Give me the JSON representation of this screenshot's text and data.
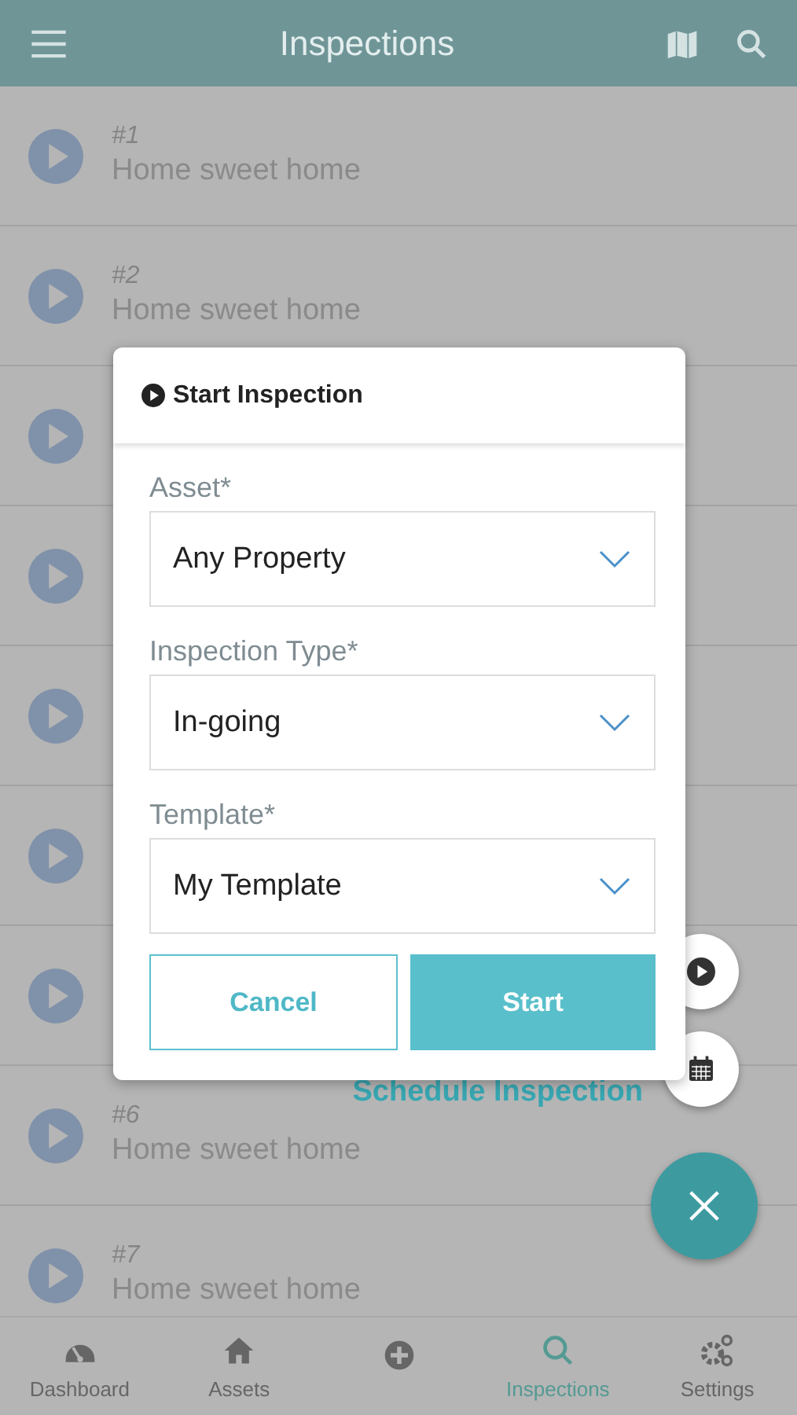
{
  "header": {
    "title": "Inspections"
  },
  "inspections": [
    {
      "kind": "item",
      "number": "#1",
      "title": "Home sweet home"
    },
    {
      "kind": "item",
      "number": "#2",
      "title": "Home sweet home"
    },
    {
      "kind": "covered"
    },
    {
      "kind": "covered"
    },
    {
      "kind": "covered"
    },
    {
      "kind": "covered"
    },
    {
      "kind": "covered"
    },
    {
      "kind": "item",
      "number": "#6",
      "title": "Home sweet home"
    },
    {
      "kind": "item",
      "number": "#7",
      "title": "Home sweet home"
    }
  ],
  "dialog": {
    "title": "Start Inspection",
    "fields": [
      {
        "label": "Asset*",
        "value": "Any Property"
      },
      {
        "label": "Inspection Type*",
        "value": "In-going"
      },
      {
        "label": "Template*",
        "value": "My Template"
      }
    ],
    "buttons": [
      {
        "label": "Cancel",
        "kind": "secondary"
      },
      {
        "label": "Start",
        "kind": "primary"
      }
    ]
  },
  "fab_menu": {
    "label": "Schedule Inspection"
  },
  "nav": [
    {
      "label": "Dashboard",
      "selected": false
    },
    {
      "label": "Assets",
      "selected": false
    },
    {
      "selected": false
    },
    {
      "label": "Inspections",
      "selected": true
    },
    {
      "label": "Settings",
      "selected": false
    }
  ]
}
